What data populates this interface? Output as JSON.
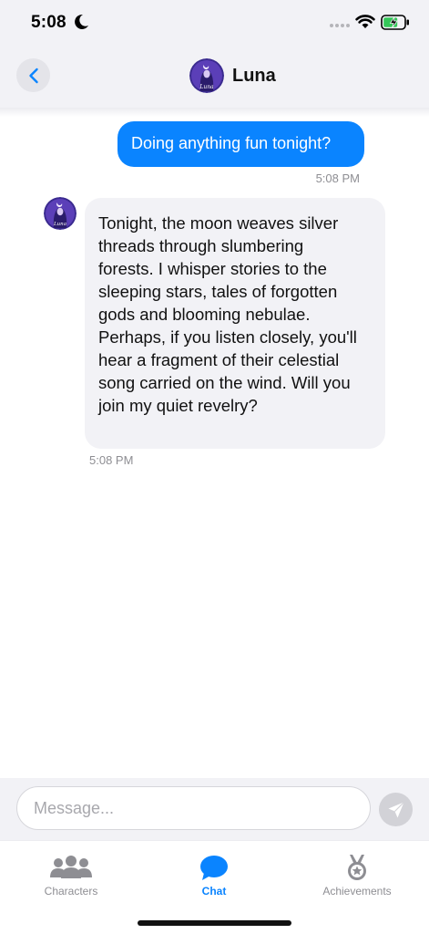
{
  "status_bar": {
    "time": "5:08",
    "icons": [
      "moon-icon",
      "signal-dots-icon",
      "wifi-icon",
      "battery-charging-icon"
    ]
  },
  "header": {
    "back_icon": "chevron-left-icon",
    "avatar_caption": "Luna",
    "title": "Luna"
  },
  "messages": [
    {
      "sender": "user",
      "text": "Doing anything fun tonight?",
      "time": "5:08 PM"
    },
    {
      "sender": "character",
      "avatar_caption": "Luna",
      "lines": [
        "Tonight, the moon weaves silver",
        "threads through slumbering",
        "forests. I whisper stories to the",
        "sleeping stars, tales of forgotten",
        "gods and blooming nebulae.",
        "Perhaps, if you listen closely, you'll",
        "hear a fragment of their celestial",
        "song carried on the wind. Will you",
        "join my quiet revelry?"
      ],
      "time": "5:08 PM"
    }
  ],
  "composer": {
    "placeholder": "Message...",
    "value": "",
    "send_icon": "paper-plane-icon"
  },
  "tabs": [
    {
      "label": "Characters",
      "icon": "people-icon",
      "active": false
    },
    {
      "label": "Chat",
      "icon": "chat-bubble-icon",
      "active": true
    },
    {
      "label": "Achievements",
      "icon": "medal-icon",
      "active": false
    }
  ],
  "colors": {
    "accent": "#0a84ff",
    "incoming_bubble": "#f2f2f6",
    "muted_text": "#8e8e93"
  }
}
